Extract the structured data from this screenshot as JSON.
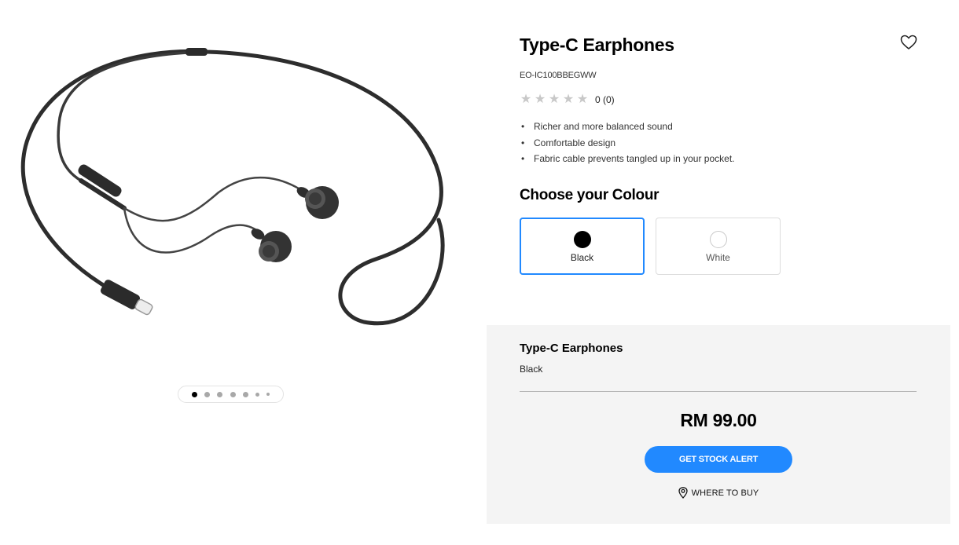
{
  "gallery": {
    "image_alt": "Type-C Earphones",
    "slide_count": 7,
    "active_slide": 1
  },
  "product": {
    "title": "Type-C Earphones",
    "sku": "EO-IC100BBEGWW",
    "rating_value": 0,
    "rating_text": "0 (0)",
    "features": [
      "Richer and more balanced sound",
      "Comfortable design",
      "Fabric cable prevents tangled up in your pocket."
    ]
  },
  "colour_selector": {
    "heading": "Choose your Colour",
    "options": [
      {
        "label": "Black",
        "color": "#000000",
        "selected": true
      },
      {
        "label": "White",
        "color": "#ffffff",
        "selected": false
      }
    ]
  },
  "summary": {
    "name": "Type-C Earphones",
    "colour": "Black",
    "price": "RM 99.00",
    "stock_alert_label": "GET STOCK ALERT",
    "where_to_buy_label": "WHERE TO BUY"
  },
  "colors": {
    "accent": "#2189ff",
    "panel_bg": "#f4f4f4",
    "star_empty": "#c8c8c8"
  },
  "icons": {
    "wishlist": "heart-outline-icon",
    "location": "location-pin-icon",
    "rating": "star-icon"
  }
}
